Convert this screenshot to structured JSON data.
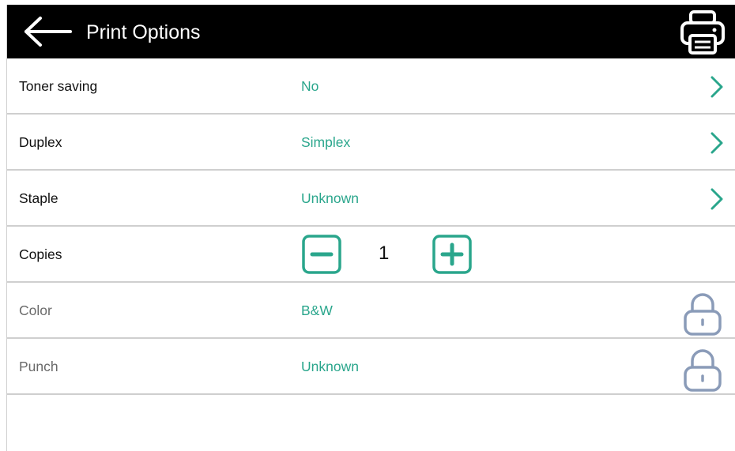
{
  "header": {
    "title": "Print Options",
    "back_icon": "back-arrow-icon",
    "print_icon": "printer-icon"
  },
  "colors": {
    "header_bg": "#000000",
    "accent": "#2aa68c",
    "lock": "#8a9bb8",
    "divider": "#cfcfcf"
  },
  "options": [
    {
      "label": "Toner saving",
      "value": "No",
      "action": "chevron-right-icon"
    },
    {
      "label": "Duplex",
      "value": "Simplex",
      "action": "chevron-right-icon"
    },
    {
      "label": "Staple",
      "value": "Unknown",
      "action": "chevron-right-icon"
    }
  ],
  "copies": {
    "label": "Copies",
    "value": "1",
    "decrement_icon": "minus-icon",
    "increment_icon": "plus-icon"
  },
  "locked_options": [
    {
      "label": "Color",
      "value": "B&W",
      "icon": "lock-icon"
    },
    {
      "label": "Punch",
      "value": "Unknown",
      "icon": "lock-icon"
    }
  ]
}
